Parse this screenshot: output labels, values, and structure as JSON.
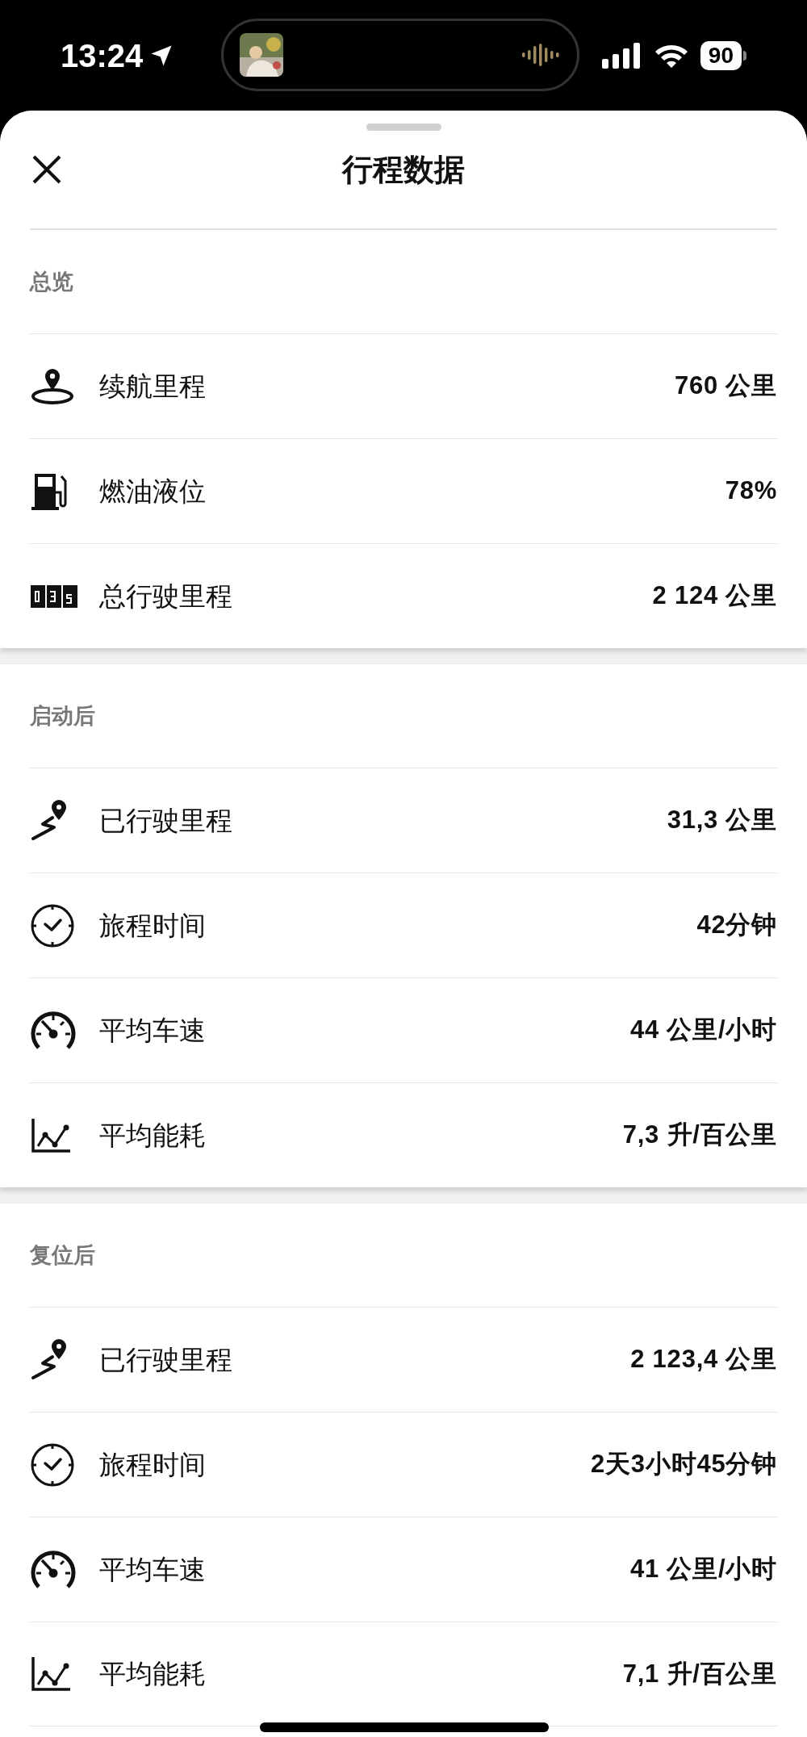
{
  "status_bar": {
    "time": "13:24",
    "battery": "90"
  },
  "header": {
    "title": "行程数据"
  },
  "sections": [
    {
      "title": "总览",
      "rows": [
        {
          "kind": "range",
          "label": "续航里程",
          "value": "760 公里"
        },
        {
          "kind": "fuel",
          "label": "燃油液位",
          "value": "78%"
        },
        {
          "kind": "odometer",
          "label": "总行驶里程",
          "value": "2 124 公里"
        }
      ]
    },
    {
      "title": "启动后",
      "rows": [
        {
          "kind": "distance",
          "label": "已行驶里程",
          "value": "31,3 公里"
        },
        {
          "kind": "time",
          "label": "旅程时间",
          "value": "42分钟"
        },
        {
          "kind": "speed",
          "label": "平均车速",
          "value": "44 公里/小时"
        },
        {
          "kind": "consumption",
          "label": "平均能耗",
          "value": "7,3 升/百公里"
        }
      ]
    },
    {
      "title": "复位后",
      "rows": [
        {
          "kind": "distance",
          "label": "已行驶里程",
          "value": "2 123,4 公里"
        },
        {
          "kind": "time",
          "label": "旅程时间",
          "value": "2天3小时45分钟"
        },
        {
          "kind": "speed",
          "label": "平均车速",
          "value": "41 公里/小时"
        },
        {
          "kind": "consumption",
          "label": "平均能耗",
          "value": "7,1 升/百公里"
        }
      ]
    }
  ]
}
